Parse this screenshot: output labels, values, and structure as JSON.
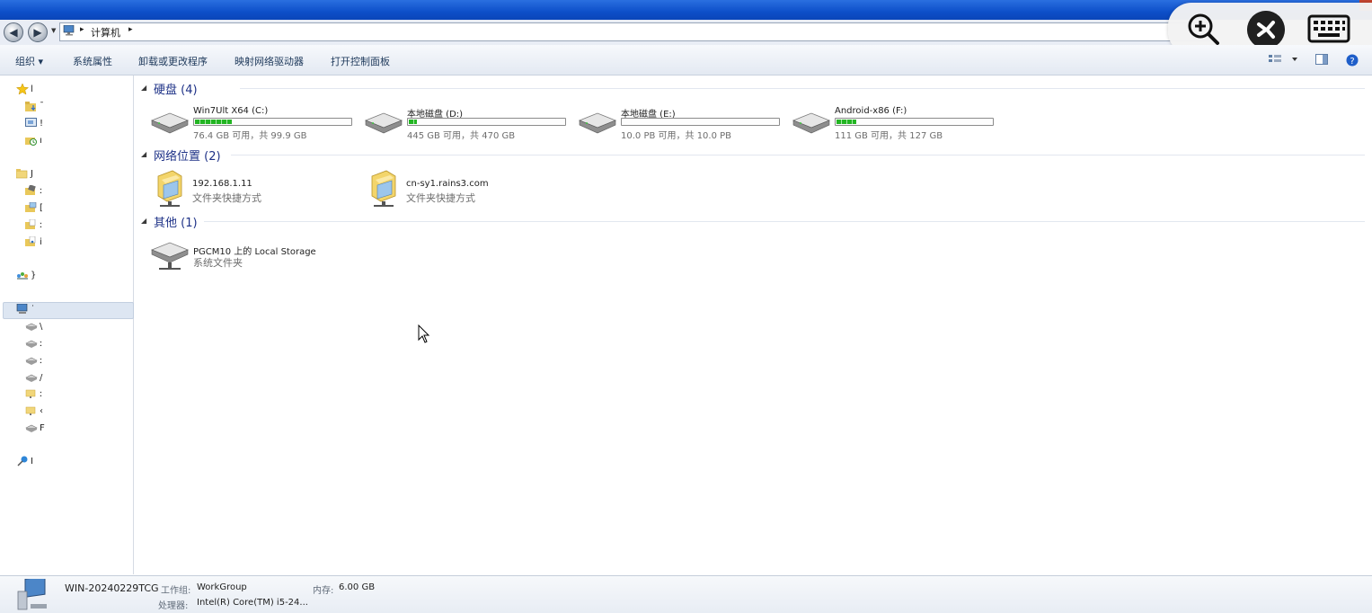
{
  "address": {
    "path_segment": "计算机",
    "separator": "▸",
    "back_arrow": "arrow-left-icon",
    "forward_arrow": "arrow-right-icon"
  },
  "toolbar": {
    "organize": "组织 ▾",
    "system_properties": "系统属性",
    "uninstall": "卸载或更改程序",
    "map_drive": "映射网络驱动器",
    "control_panel": "打开控制面板"
  },
  "nav": {
    "items": [
      {
        "label": "l",
        "icon": "star-icon"
      },
      {
        "label": "ˉ",
        "icon": "folder-download-icon"
      },
      {
        "label": "!",
        "icon": "desktop-icon"
      },
      {
        "label": "ı",
        "icon": "recent-places-icon"
      },
      {
        "label": "J",
        "icon": "libraries-icon"
      },
      {
        "label": "ː",
        "icon": "library-video-icon"
      },
      {
        "label": "[",
        "icon": "library-pictures-icon"
      },
      {
        "label": "ː",
        "icon": "library-documents-icon"
      },
      {
        "label": "i",
        "icon": "library-music-icon"
      },
      {
        "label": "}",
        "icon": "homegroup-icon"
      },
      {
        "label": "˙",
        "icon": "computer-icon"
      },
      {
        "label": "\\",
        "icon": "drive-icon"
      },
      {
        "label": "ː",
        "icon": "drive-icon"
      },
      {
        "label": "ː",
        "icon": "drive-icon"
      },
      {
        "label": "/",
        "icon": "drive-icon"
      },
      {
        "label": "ː",
        "icon": "network-folder-icon"
      },
      {
        "label": "‹",
        "icon": "network-folder-icon"
      },
      {
        "label": "F",
        "icon": "drive-icon"
      },
      {
        "label": "I",
        "icon": "network-icon"
      }
    ]
  },
  "groups": {
    "hard_disks": "硬盘 (4)",
    "network_locations": "网络位置 (2)",
    "other": "其他 (1)"
  },
  "drives": [
    {
      "name": "Win7Ult X64 (C:)",
      "size": "76.4 GB 可用，共 99.9 GB",
      "used_fraction": 0.235
    },
    {
      "name": "本地磁盘 (D:)",
      "size": "445 GB 可用，共 470 GB",
      "used_fraction": 0.053
    },
    {
      "name": "本地磁盘 (E:)",
      "size": "10.0 PB 可用，共 10.0 PB",
      "used_fraction": 0.0
    },
    {
      "name": "Android-x86 (F:)",
      "size": "111 GB 可用，共 127 GB",
      "used_fraction": 0.126
    }
  ],
  "network": [
    {
      "name": "192.168.1.11",
      "type": "文件夹快捷方式"
    },
    {
      "name": "cn-sy1.rains3.com",
      "type": "文件夹快捷方式"
    }
  ],
  "other_items": [
    {
      "name": "PGCM10 上的 Local Storage",
      "type": "系统文件夹"
    }
  ],
  "details": {
    "computer_name": "WIN-20240229TCG",
    "workgroup_label": "工作组:",
    "workgroup_value": "WorkGroup",
    "memory_label": "内存:",
    "memory_value": "6.00 GB",
    "cpu_label": "处理器:",
    "cpu_value": "Intel(R) Core(TM) i5-24..."
  },
  "overlay": {
    "zoom_icon": "zoom-in-icon",
    "remote_icon": "remote-desktop-icon",
    "keyboard_icon": "keyboard-icon"
  },
  "colors": {
    "accent_title": "#1e3287",
    "disk_bar": "#23b523",
    "titlebar": "#0d4fc9"
  }
}
